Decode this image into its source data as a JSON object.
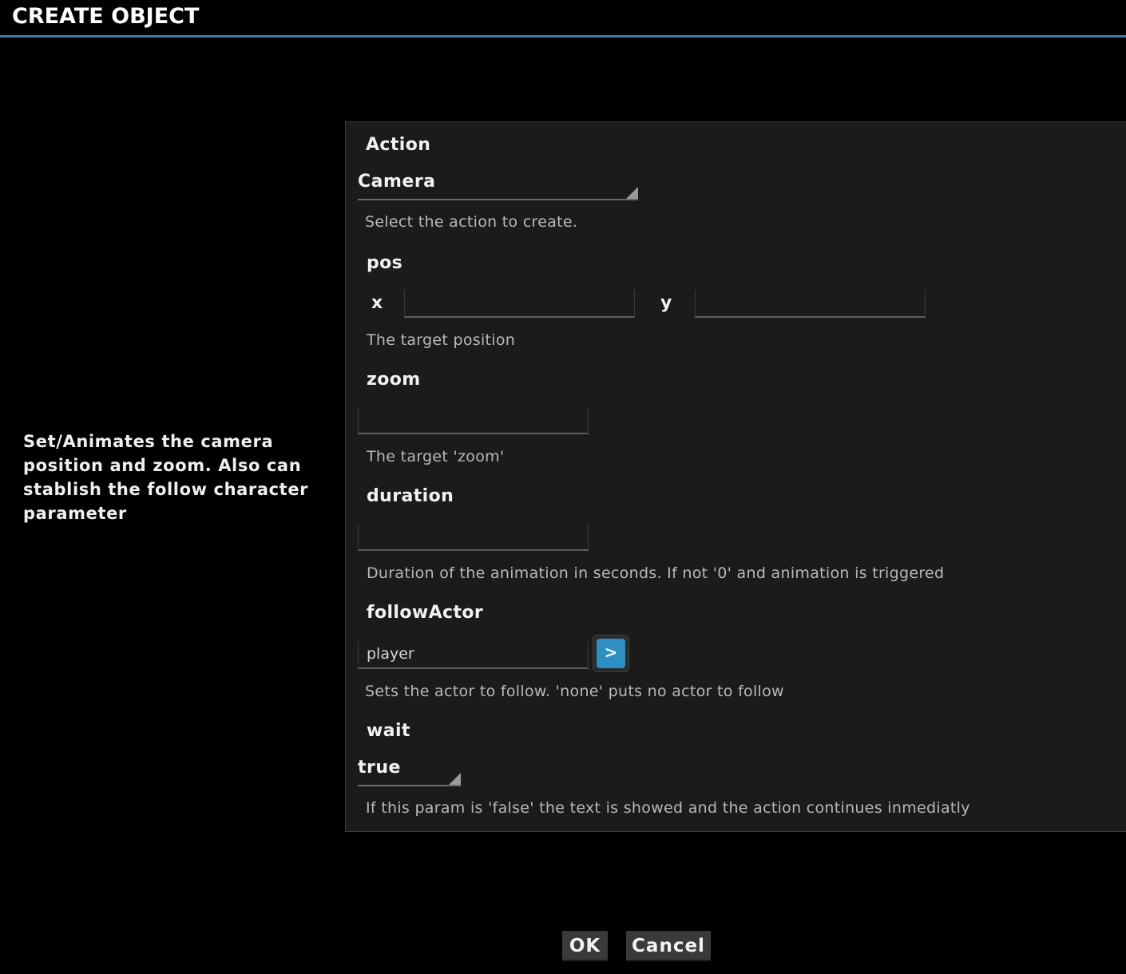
{
  "window": {
    "title": "CREATE OBJECT"
  },
  "description": "Set/Animates the camera position and zoom. Also can stablish the follow character parameter",
  "form": {
    "action": {
      "label": "Action",
      "value": "Camera",
      "help": "Select the action to create."
    },
    "pos": {
      "label": "pos",
      "x_label": "x",
      "x_value": "",
      "y_label": "y",
      "y_value": "",
      "help": "The target position"
    },
    "zoom": {
      "label": "zoom",
      "value": "",
      "help": "The target 'zoom'"
    },
    "duration": {
      "label": "duration",
      "value": "",
      "help": "Duration of the animation in seconds. If not '0' and animation is triggered"
    },
    "followActor": {
      "label": "followActor",
      "value": "player",
      "button_label": ">",
      "help": "Sets the actor to follow. 'none' puts no actor to follow"
    },
    "wait": {
      "label": "wait",
      "value": "true",
      "help": "If this param is 'false' the text is showed and the action continues inmediatly"
    }
  },
  "buttons": {
    "ok": "OK",
    "cancel": "Cancel"
  },
  "colors": {
    "accent": "#3c7fa6",
    "button_blue": "#2e8fc4",
    "panel_bg": "#1b1b1b",
    "background": "#000000"
  }
}
